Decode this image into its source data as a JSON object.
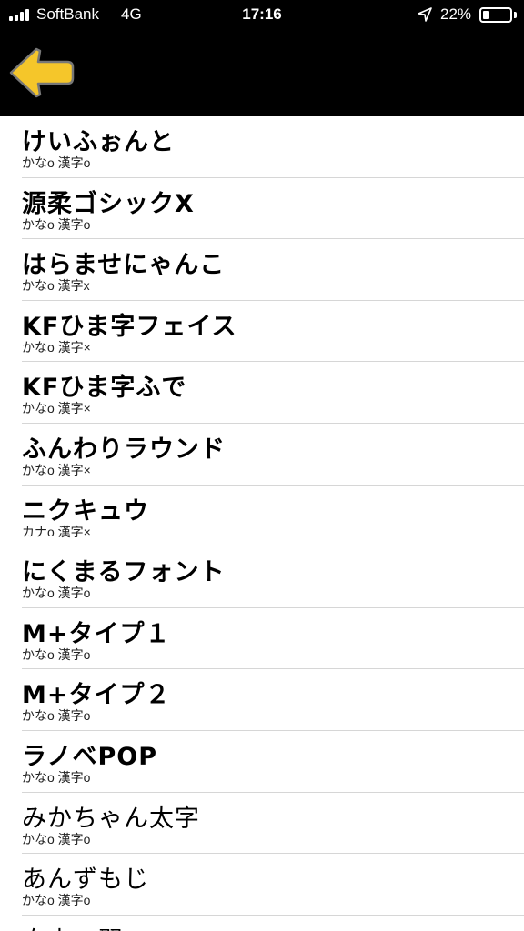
{
  "status_bar": {
    "carrier": "SoftBank",
    "network": "4G",
    "time": "17:16",
    "battery_percent": "22%",
    "battery_level": 0.22,
    "icons": [
      "signal-bars-icon",
      "location-arrow-icon",
      "battery-icon"
    ]
  },
  "nav": {
    "back_icon": "yellow-left-arrow-icon",
    "accent_color": "#f5c62a"
  },
  "fonts": [
    {
      "name": "けいふぉんと",
      "support": "かなo 漢字o"
    },
    {
      "name": "源柔ゴシックX",
      "support": "かなo 漢字o"
    },
    {
      "name": "はらませにゃんこ",
      "support": "かなo 漢字x"
    },
    {
      "name": "KFひま字フェイス",
      "support": "かなo 漢字×"
    },
    {
      "name": "KFひま字ふで",
      "support": "かなo 漢字×"
    },
    {
      "name": "ふんわりラウンド",
      "support": "かなo 漢字×"
    },
    {
      "name": "ニクキュウ",
      "support": "カナo 漢字×"
    },
    {
      "name": "にくまるフォント",
      "support": "かなo 漢字o"
    },
    {
      "name": "M+タイプ１",
      "support": "かなo 漢字o"
    },
    {
      "name": "M+タイプ２",
      "support": "かなo 漢字o"
    },
    {
      "name": "ラノベPOP",
      "support": "かなo 漢字o"
    },
    {
      "name": "みかちゃん太字",
      "support": "かなo 漢字o"
    },
    {
      "name": "あんずもじ",
      "support": "かなo 漢字o"
    },
    {
      "name": "自由の翼",
      "support": ""
    }
  ]
}
